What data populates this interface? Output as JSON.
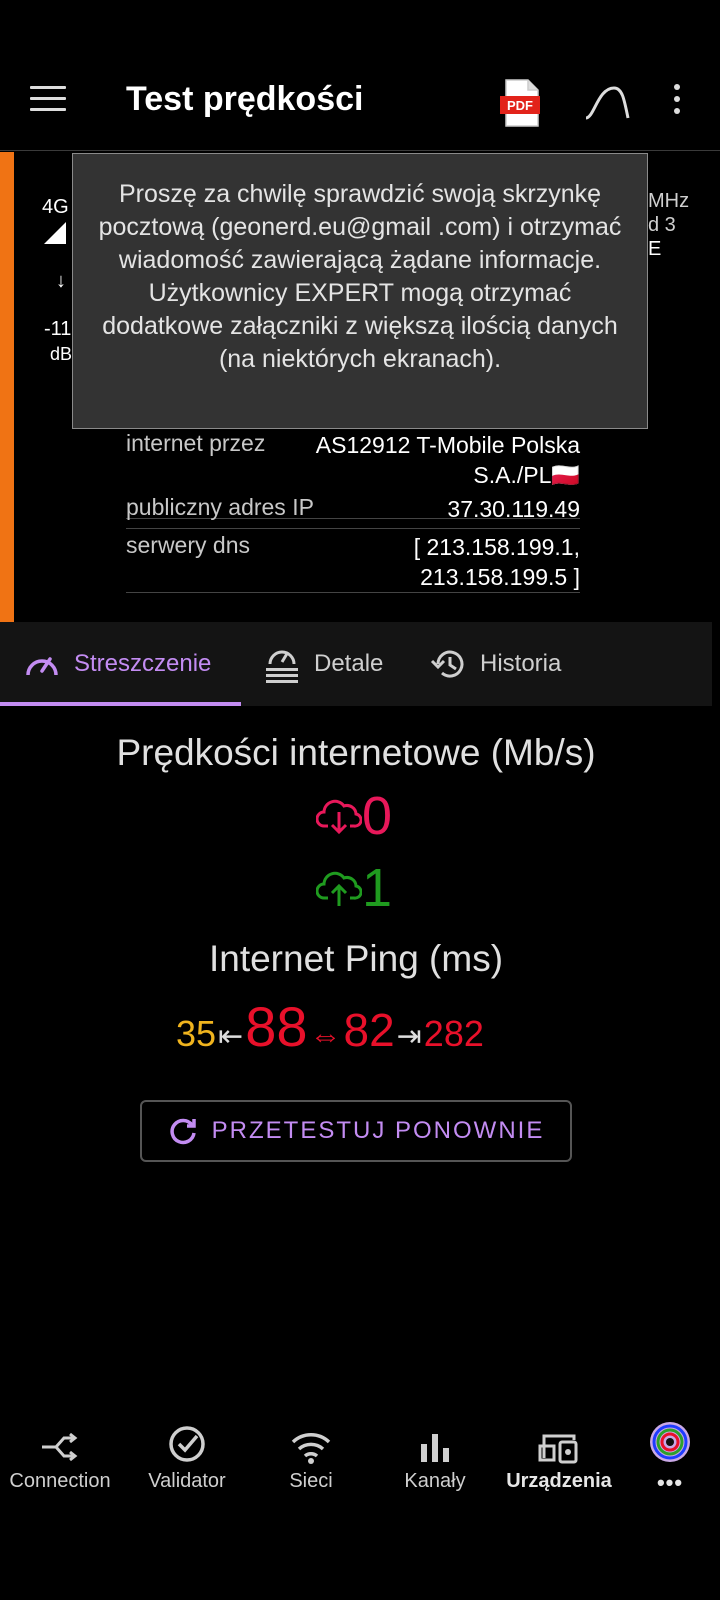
{
  "header": {
    "title": "Test prędkości",
    "pdf_label": "PDF"
  },
  "signal": {
    "tech": "4G",
    "value": "-11",
    "unit": "dB",
    "freq": "MHz",
    "band": "d 3",
    "extra": "E"
  },
  "tooltip": {
    "text": "Proszę za chwilę sprawdzić swoją skrzynkę pocztową (geonerd.eu@gmail .com) i otrzymać wiadomość zawierającą żądane informacje. Użytkownicy EXPERT mogą otrzymać dodatkowe załączniki z większą ilością danych (na niektórych ekranach)."
  },
  "info": {
    "rows": [
      {
        "label": "internet przez",
        "value_line1": "AS12912 T-Mobile Polska",
        "value_line2": "S.A./PL🇵🇱"
      },
      {
        "label": "publiczny adres IP",
        "value_line1": "37.30.119.49"
      },
      {
        "label": "serwery dns",
        "value_line1": "[ 213.158.199.1,",
        "value_line2": "213.158.199.5 ]"
      }
    ]
  },
  "tabs": [
    {
      "label": "Streszczenie",
      "active": true
    },
    {
      "label": "Detale",
      "active": false
    },
    {
      "label": "Historia",
      "active": false
    }
  ],
  "summary": {
    "speed_title": "Prędkości internetowe (Mb/s)",
    "download": "0",
    "upload": "1",
    "ping_title": "Internet Ping (ms)",
    "ping_min": "35",
    "ping_avg": "88",
    "ping_jitter": "82",
    "ping_max": "282",
    "retest_label": "PRZETESTUJ PONOWNIE"
  },
  "colors": {
    "accent": "#c38cf2",
    "download": "#e8185a",
    "upload": "#1f9b1f",
    "ping_min": "#f0b41e",
    "ping_red": "#e8102a",
    "orange": "#f07314"
  },
  "bottom_nav": [
    {
      "label": "Connection",
      "icon": "connection-icon",
      "bold": false
    },
    {
      "label": "Validator",
      "icon": "check-circle-icon",
      "bold": false
    },
    {
      "label": "Sieci",
      "icon": "wifi-icon",
      "bold": false
    },
    {
      "label": "Kanały",
      "icon": "bar-chart-icon",
      "bold": false
    },
    {
      "label": "Urządzenia",
      "icon": "devices-icon",
      "bold": true
    },
    {
      "label": "•••",
      "icon": "more-icon",
      "bold": true
    }
  ]
}
